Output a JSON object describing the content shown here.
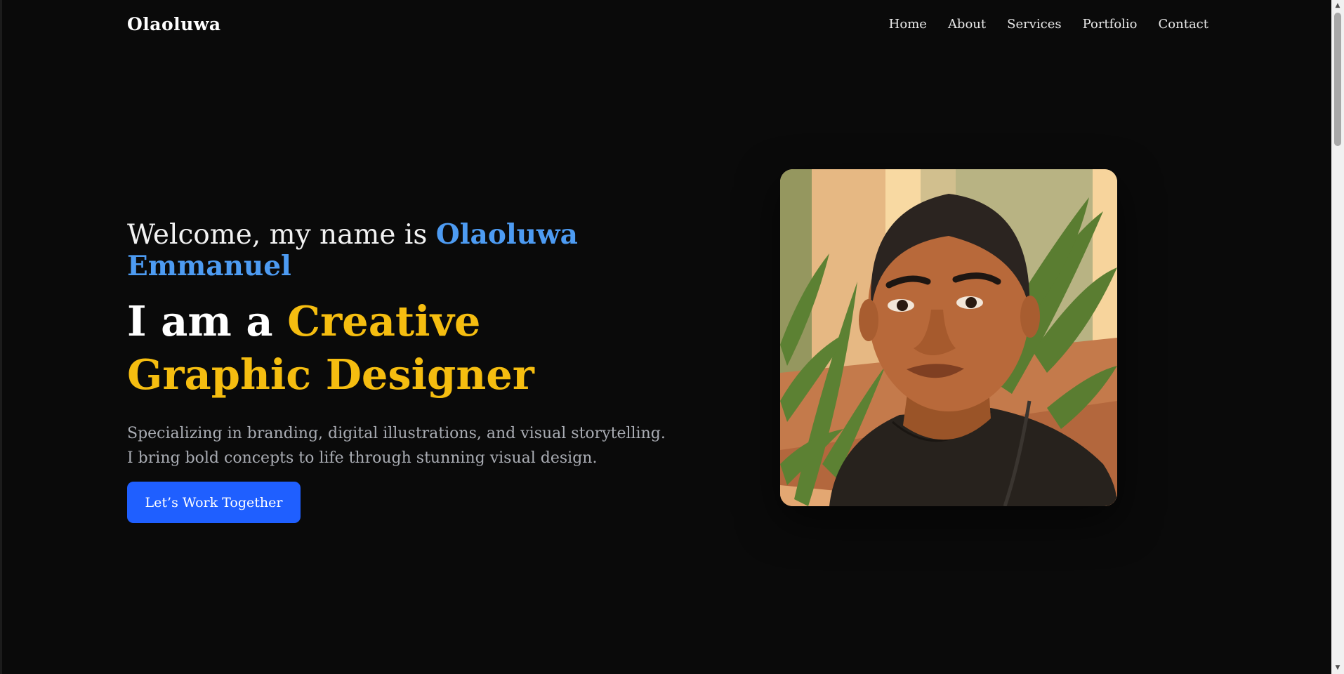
{
  "brand": "Olaoluwa",
  "nav": [
    {
      "label": "Home"
    },
    {
      "label": "About"
    },
    {
      "label": "Services"
    },
    {
      "label": "Portfolio"
    },
    {
      "label": "Contact"
    }
  ],
  "hero": {
    "welcome_prefix": "Welcome, my name is ",
    "welcome_name": "Olaoluwa Emmanuel",
    "headline_prefix": "I am a ",
    "headline_role": "Creative Graphic Designer",
    "description_line1": "Specializing in branding, digital illustrations, and visual storytelling.",
    "description_line2": "I bring bold concepts to life through stunning visual design.",
    "cta_label": "Let’s Work Together"
  },
  "colors": {
    "background": "#0a0a0a",
    "name_accent": "#4d9bf2",
    "role_accent": "#f5bd10",
    "cta_background": "#1f5fff",
    "description_text": "#a9acb3"
  },
  "icons": {
    "portrait": "illustrated-portrait",
    "scroll_up": "scroll-up-arrow-icon",
    "scroll_down": "scroll-down-arrow-icon"
  }
}
